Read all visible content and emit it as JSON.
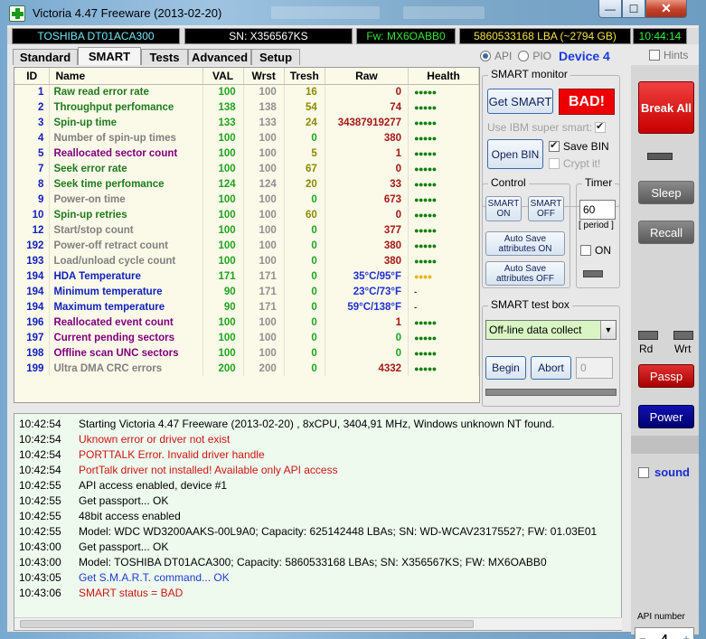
{
  "window": {
    "title": "Victoria 4.47  Freeware (2013-02-20)",
    "min": "—",
    "max": "☐",
    "close": "✕"
  },
  "info": {
    "model": "TOSHIBA DT01ACA300",
    "serial": "SN: X356567KS",
    "firmware": "Fw: MX6OABB0",
    "lba": "5860533168 LBA (~2794 GB)",
    "time": "10:44:14"
  },
  "tabs": [
    "Standard",
    "SMART",
    "Tests",
    "Advanced",
    "Setup"
  ],
  "api": {
    "api_label": "API",
    "pio_label": "PIO",
    "device_label": "Device 4",
    "hints_label": "Hints"
  },
  "smart_table": {
    "headers": [
      "ID",
      "Name",
      "VAL",
      "Wrst",
      "Tresh",
      "Raw",
      "Health"
    ],
    "rows": [
      {
        "id": "1",
        "name": "Raw read error rate",
        "val": "100",
        "wrst": "100",
        "tresh": "16",
        "raw": "0",
        "health": "●●●●●",
        "name_color": "green",
        "val_color": "green",
        "tresh_color": "olive",
        "health_color": "green",
        "raw_color": "red"
      },
      {
        "id": "2",
        "name": "Throughput perfomance",
        "val": "138",
        "wrst": "138",
        "tresh": "54",
        "raw": "74",
        "health": "●●●●●",
        "name_color": "green",
        "val_color": "green",
        "tresh_color": "olive",
        "health_color": "green",
        "raw_color": "red"
      },
      {
        "id": "3",
        "name": "Spin-up time",
        "val": "133",
        "wrst": "133",
        "tresh": "24",
        "raw": "34387919277",
        "health": "●●●●●",
        "name_color": "green",
        "val_color": "green",
        "tresh_color": "olive",
        "health_color": "green",
        "raw_color": "red"
      },
      {
        "id": "4",
        "name": "Number of spin-up times",
        "val": "100",
        "wrst": "100",
        "tresh": "0",
        "raw": "380",
        "health": "●●●●●",
        "name_color": "gray",
        "val_color": "green",
        "tresh_color": "green",
        "health_color": "green",
        "raw_color": "red"
      },
      {
        "id": "5",
        "name": "Reallocated sector count",
        "val": "100",
        "wrst": "100",
        "tresh": "5",
        "raw": "1",
        "health": "●●●●●",
        "name_color": "purple",
        "val_color": "green",
        "tresh_color": "olive",
        "health_color": "green",
        "raw_color": "red"
      },
      {
        "id": "7",
        "name": "Seek error rate",
        "val": "100",
        "wrst": "100",
        "tresh": "67",
        "raw": "0",
        "health": "●●●●●",
        "name_color": "green",
        "val_color": "green",
        "tresh_color": "olive",
        "health_color": "green",
        "raw_color": "red"
      },
      {
        "id": "8",
        "name": "Seek time perfomance",
        "val": "124",
        "wrst": "124",
        "tresh": "20",
        "raw": "33",
        "health": "●●●●●",
        "name_color": "green",
        "val_color": "green",
        "tresh_color": "olive",
        "health_color": "green",
        "raw_color": "red"
      },
      {
        "id": "9",
        "name": "Power-on time",
        "val": "100",
        "wrst": "100",
        "tresh": "0",
        "raw": "673",
        "health": "●●●●●",
        "name_color": "gray",
        "val_color": "green",
        "tresh_color": "green",
        "health_color": "green",
        "raw_color": "red"
      },
      {
        "id": "10",
        "name": "Spin-up retries",
        "val": "100",
        "wrst": "100",
        "tresh": "60",
        "raw": "0",
        "health": "●●●●●",
        "name_color": "green",
        "val_color": "green",
        "tresh_color": "olive",
        "health_color": "green",
        "raw_color": "red"
      },
      {
        "id": "12",
        "name": "Start/stop count",
        "val": "100",
        "wrst": "100",
        "tresh": "0",
        "raw": "377",
        "health": "●●●●●",
        "name_color": "gray",
        "val_color": "green",
        "tresh_color": "green",
        "health_color": "green",
        "raw_color": "red"
      },
      {
        "id": "192",
        "name": "Power-off retract count",
        "val": "100",
        "wrst": "100",
        "tresh": "0",
        "raw": "380",
        "health": "●●●●●",
        "name_color": "gray",
        "val_color": "green",
        "tresh_color": "green",
        "health_color": "green",
        "raw_color": "red"
      },
      {
        "id": "193",
        "name": "Load/unload cycle count",
        "val": "100",
        "wrst": "100",
        "tresh": "0",
        "raw": "380",
        "health": "●●●●●",
        "name_color": "gray",
        "val_color": "green",
        "tresh_color": "green",
        "health_color": "green",
        "raw_color": "red"
      },
      {
        "id": "194",
        "name": "HDA Temperature",
        "val": "171",
        "wrst": "171",
        "tresh": "0",
        "raw": "35°C/95°F",
        "health": "●●●●",
        "name_color": "blue",
        "val_color": "green",
        "tresh_color": "green",
        "health_color": "yellow",
        "raw_color": "blue"
      },
      {
        "id": "194",
        "name": "Minimum temperature",
        "val": "90",
        "wrst": "171",
        "tresh": "0",
        "raw": "23°C/73°F",
        "health": "-",
        "name_color": "blue",
        "val_color": "green",
        "tresh_color": "green",
        "health_color": "black",
        "raw_color": "blue"
      },
      {
        "id": "194",
        "name": "Maximum temperature",
        "val": "90",
        "wrst": "171",
        "tresh": "0",
        "raw": "59°C/138°F",
        "health": "-",
        "name_color": "blue",
        "val_color": "green",
        "tresh_color": "green",
        "health_color": "black",
        "raw_color": "blue"
      },
      {
        "id": "196",
        "name": "Reallocated event count",
        "val": "100",
        "wrst": "100",
        "tresh": "0",
        "raw": "1",
        "health": "●●●●●",
        "name_color": "purple",
        "val_color": "green",
        "tresh_color": "green",
        "health_color": "green",
        "raw_color": "red"
      },
      {
        "id": "197",
        "name": "Current pending sectors",
        "val": "100",
        "wrst": "100",
        "tresh": "0",
        "raw": "0",
        "health": "●●●●●",
        "name_color": "purple",
        "val_color": "green",
        "tresh_color": "green",
        "health_color": "green",
        "raw_color": "green"
      },
      {
        "id": "198",
        "name": "Offline scan UNC sectors",
        "val": "100",
        "wrst": "100",
        "tresh": "0",
        "raw": "0",
        "health": "●●●●●",
        "name_color": "purple",
        "val_color": "green",
        "tresh_color": "green",
        "health_color": "green",
        "raw_color": "green"
      },
      {
        "id": "199",
        "name": "Ultra DMA CRC errors",
        "val": "200",
        "wrst": "200",
        "tresh": "0",
        "raw": "4332",
        "health": "●●●●●",
        "name_color": "gray",
        "val_color": "green",
        "tresh_color": "green",
        "health_color": "green",
        "raw_color": "red"
      }
    ]
  },
  "smart_monitor": {
    "label": "SMART monitor",
    "get_smart": "Get SMART",
    "status": "BAD!",
    "ibm_label": "Use IBM super smart:",
    "open_bin": "Open BIN",
    "save_bin": "Save BIN",
    "crypt_it": "Crypt it!"
  },
  "control": {
    "label": "Control",
    "smart_on": "SMART ON",
    "smart_off": "SMART OFF",
    "auto_save_on": "Auto Save attributes ON",
    "auto_save_off": "Auto Save attributes OFF"
  },
  "timer": {
    "label": "Timer",
    "value": "60",
    "period_label": "[ period ]",
    "on_label": "ON"
  },
  "test_box": {
    "label": "SMART test box",
    "selected": "Off-line data collect",
    "begin": "Begin",
    "abort": "Abort",
    "lba_value": "0"
  },
  "right_panel": {
    "break_all": "Break All",
    "sleep": "Sleep",
    "recall": "Recall",
    "rd_label": "Rd",
    "wrt_label": "Wrt",
    "passp": "Passp",
    "power": "Power",
    "sound_label": "sound",
    "api_number_label": "API number",
    "api_number": "4",
    "minus": "−",
    "plus": "+"
  },
  "log": [
    {
      "time": "10:42:54",
      "msg": "Starting Victoria 4.47  Freeware (2013-02-20) , 8xCPU, 3404,91 MHz, Windows unknown NT found.",
      "color": "black"
    },
    {
      "time": "10:42:54",
      "msg": "Uknown error or driver not exist",
      "color": "red"
    },
    {
      "time": "10:42:54",
      "msg": "PORTTALK Error. Invalid driver handle",
      "color": "red"
    },
    {
      "time": "10:42:54",
      "msg": "PortTalk driver not installed! Available only API access",
      "color": "red"
    },
    {
      "time": "10:42:55",
      "msg": "API access enabled, device #1",
      "color": "black"
    },
    {
      "time": "10:42:55",
      "msg": "Get passport... OK",
      "color": "black"
    },
    {
      "time": "10:42:55",
      "msg": "48bit access enabled",
      "color": "black"
    },
    {
      "time": "10:42:55",
      "msg": "Model: WDC WD3200AAKS-00L9A0; Capacity: 625142448 LBAs; SN: WD-WCAV23175527; FW: 01.03E01",
      "color": "black"
    },
    {
      "time": "10:43:00",
      "msg": "Get passport... OK",
      "color": "black"
    },
    {
      "time": "10:43:00",
      "msg": "Model: TOSHIBA DT01ACA300; Capacity: 5860533168 LBAs; SN: X356567KS; FW: MX6OABB0",
      "color": "black"
    },
    {
      "time": "10:43:05",
      "msg": "Get S.M.A.R.T. command... OK",
      "color": "blue"
    },
    {
      "time": "10:43:06",
      "msg": "SMART status = BAD",
      "color": "red"
    }
  ]
}
